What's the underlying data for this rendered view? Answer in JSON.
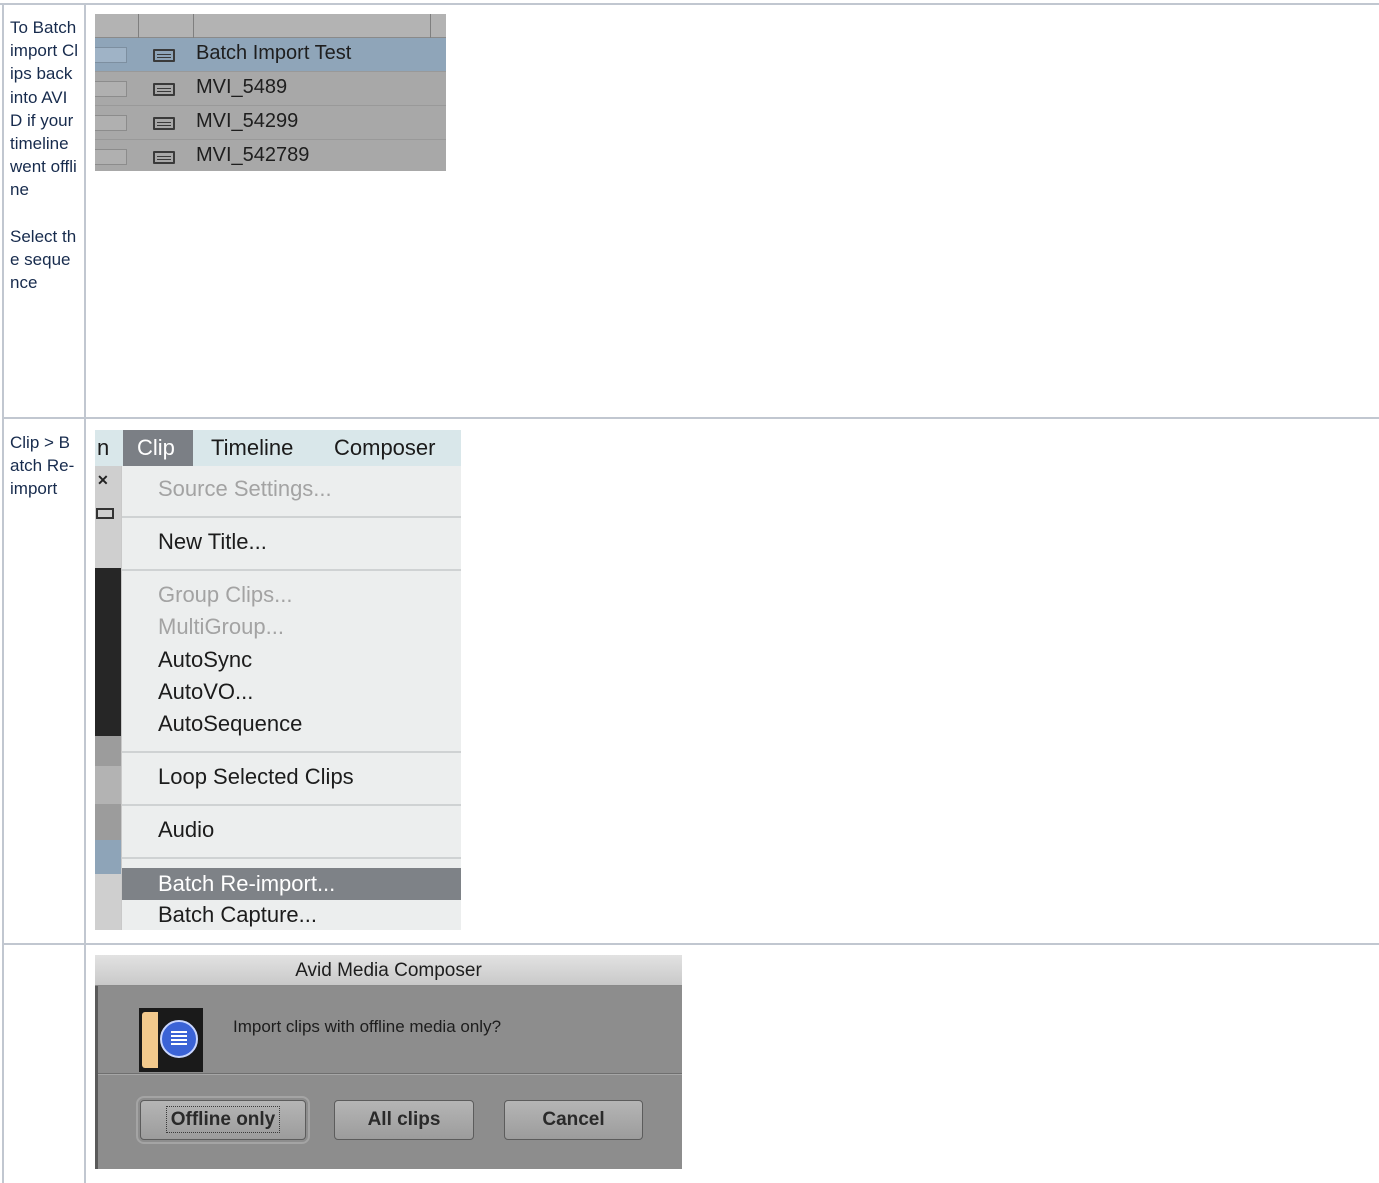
{
  "steps": [
    {
      "text": "To Batch import Clips back into AVID if your timeline went offline\n\nSelect the sequence"
    },
    {
      "text": "Clip > Batch Re-import"
    },
    {
      "text": ""
    }
  ],
  "bin": {
    "rows": [
      {
        "label": "Batch Import Test",
        "icon": "sequence-icon",
        "selected": true
      },
      {
        "label": "MVI_5489",
        "icon": "clip-icon",
        "selected": false
      },
      {
        "label": "MVI_54299",
        "icon": "clip-icon",
        "selected": false
      },
      {
        "label": "MVI_542789",
        "icon": "clip-icon",
        "selected": false
      }
    ]
  },
  "menu": {
    "partial_left": "n",
    "bar": [
      "Clip",
      "Timeline",
      "Composer"
    ],
    "items": [
      {
        "label": "Source Settings...",
        "disabled": true
      },
      {
        "label": "New Title...",
        "disabled": false
      },
      {
        "label": "Group Clips...",
        "disabled": true
      },
      {
        "label": "MultiGroup...",
        "disabled": true
      },
      {
        "label": "AutoSync",
        "disabled": false
      },
      {
        "label": "AutoVO...",
        "disabled": false
      },
      {
        "label": "AutoSequence",
        "disabled": false
      },
      {
        "label": "Loop Selected Clips",
        "disabled": false
      },
      {
        "label": "Audio",
        "disabled": false
      },
      {
        "label": "Batch Re-import...",
        "disabled": false,
        "highlighted": true
      },
      {
        "label": "Batch Capture...",
        "disabled": false
      }
    ]
  },
  "dialog": {
    "title": "Avid Media Composer",
    "message": "Import clips with offline media only?",
    "buttons": [
      "Offline only",
      "All clips",
      "Cancel"
    ]
  },
  "colors": {
    "grid": "#c1c7d0",
    "menu_highlight": "#7e8287",
    "bin_selected": "#8fa5b9"
  }
}
